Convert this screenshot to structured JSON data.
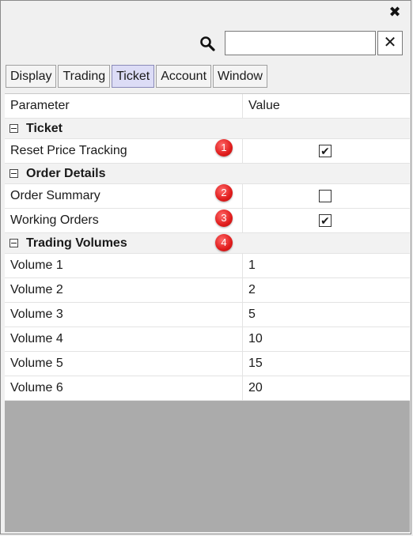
{
  "window": {
    "close_glyph": "✖"
  },
  "search": {
    "value": "",
    "placeholder": "",
    "clear_glyph": "✕",
    "icon": "search-icon"
  },
  "tabs": [
    {
      "label": "Display",
      "active": false
    },
    {
      "label": "Trading",
      "active": false
    },
    {
      "label": "Ticket",
      "active": true
    },
    {
      "label": "Account",
      "active": false
    },
    {
      "label": "Window",
      "active": false
    }
  ],
  "grid": {
    "headers": {
      "parameter": "Parameter",
      "value": "Value"
    },
    "groups": [
      {
        "title": "Ticket",
        "rows": [
          {
            "name": "Reset Price Tracking",
            "checked": true,
            "badge": "1"
          }
        ]
      },
      {
        "title": "Order Details",
        "rows": [
          {
            "name": "Order Summary",
            "checked": false,
            "badge": "2"
          },
          {
            "name": "Working Orders",
            "checked": true,
            "badge": "3"
          }
        ]
      },
      {
        "title": "Trading Volumes",
        "badge": "4",
        "rows": [
          {
            "name": "Volume 1",
            "value": "1"
          },
          {
            "name": "Volume 2",
            "value": "2"
          },
          {
            "name": "Volume 3",
            "value": "5"
          },
          {
            "name": "Volume 4",
            "value": "10"
          },
          {
            "name": "Volume 5",
            "value": "15"
          },
          {
            "name": "Volume 6",
            "value": "20"
          }
        ]
      }
    ]
  },
  "colors": {
    "active_tab": "#dcdcf6",
    "badge": "#e01c1c",
    "empty_area": "#ababab"
  },
  "check_glyph": "✔"
}
